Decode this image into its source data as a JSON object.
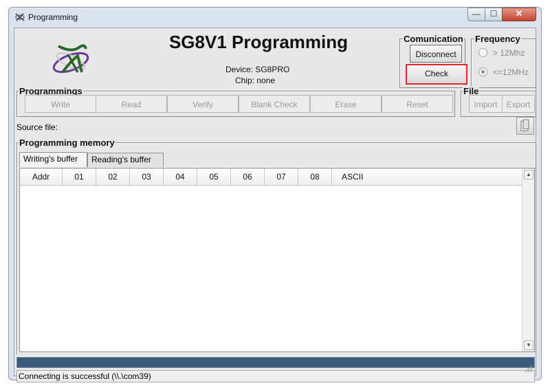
{
  "window": {
    "title": "Programming",
    "min_glyph": "—",
    "max_glyph": "☐",
    "close_glyph": "✕"
  },
  "header": {
    "title": "SG8V1 Programming",
    "device_line": "Device: SG8PRO",
    "chip_line": "Chip: none"
  },
  "communication": {
    "label": "Comunication",
    "disconnect_label": "Disconnect",
    "check_label": "Check"
  },
  "frequency": {
    "label": "Frequency",
    "options": [
      {
        "label": "> 12Mhz",
        "selected": false
      },
      {
        "label": "<=12MHz",
        "selected": true
      }
    ]
  },
  "programmings": {
    "label": "Programmings",
    "buttons": [
      "Write",
      "Read",
      "Verify",
      "Blank Check",
      "Erase",
      "Reset"
    ]
  },
  "file": {
    "label": "File",
    "import_label": "Import",
    "export_label": "Export"
  },
  "source": {
    "label": "Source file:"
  },
  "memory": {
    "label": "Programming memory",
    "tabs": [
      {
        "label": "Writing's buffer",
        "active": true
      },
      {
        "label": "Reading's buffer",
        "active": false
      }
    ],
    "columns": [
      "Addr",
      "01",
      "02",
      "03",
      "04",
      "05",
      "06",
      "07",
      "08",
      "ASCII"
    ],
    "rows": []
  },
  "status": {
    "message": "Connecting  is successful (\\\\.\\com39)"
  },
  "colors": {
    "highlight": "#e0272a",
    "progress": "#3a5a7c"
  }
}
